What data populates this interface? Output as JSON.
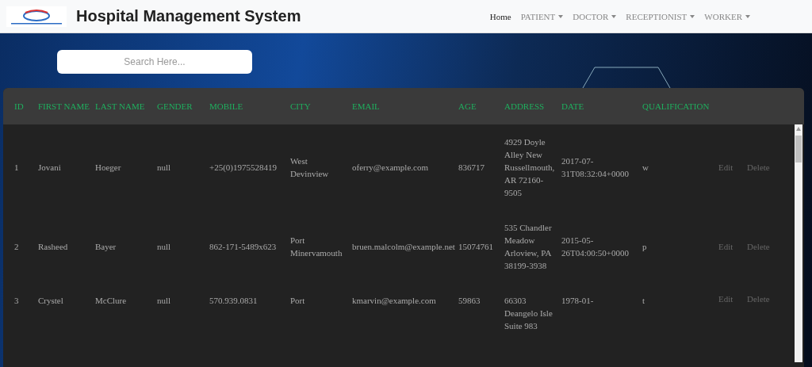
{
  "navbar": {
    "title": "Hospital Management System",
    "items": [
      {
        "label": "Home",
        "selected": true,
        "dropdown": false
      },
      {
        "label": "PATIENT",
        "selected": false,
        "dropdown": true
      },
      {
        "label": "DOCTOR",
        "selected": false,
        "dropdown": true
      },
      {
        "label": "RECEPTIONIST",
        "selected": false,
        "dropdown": true
      },
      {
        "label": "WORKER",
        "selected": false,
        "dropdown": true
      }
    ]
  },
  "search": {
    "placeholder": "Search Here..."
  },
  "table": {
    "columns": [
      "ID",
      "FIRST NAME",
      "LAST NAME",
      "GENDER",
      "MOBILE",
      "CITY",
      "EMAIL",
      "AGE",
      "ADDRESS",
      "DATE",
      "QUALIFICATION"
    ],
    "rows": [
      {
        "cells": [
          "1",
          "Jovani",
          "Hoeger",
          "null",
          "+25(0)1975528419",
          "West Devinview",
          "oferry@example.com",
          "836717",
          "4929 Doyle Alley New Russellmouth, AR 72160-9505",
          "2017-07-31T08:32:04+0000",
          "w"
        ],
        "actions": [
          "Edit",
          "Delete"
        ]
      },
      {
        "cells": [
          "2",
          "Rasheed",
          "Bayer",
          "null",
          "862-171-5489x623",
          "Port Minervamouth",
          "bruen.malcolm@example.net",
          "15074761",
          "535 Chandler Meadow Arloview, PA 38199-3938",
          "2015-05-26T04:00:50+0000",
          "p"
        ],
        "actions": [
          "Edit",
          "Delete"
        ]
      },
      {
        "cells": [
          "3",
          "Crystel",
          "McClure",
          "null",
          "570.939.0831",
          "Port",
          "kmarvin@example.com",
          "59863",
          "66303 Deangelo Isle Suite 983",
          "1978-01-",
          "t"
        ],
        "actions": [
          "Edit",
          "Delete"
        ]
      }
    ]
  }
}
